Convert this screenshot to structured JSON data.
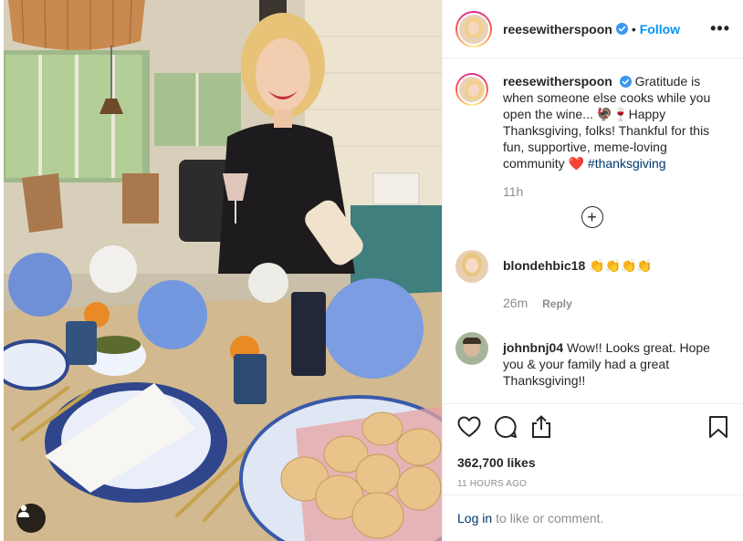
{
  "photo": {
    "alt": "photo",
    "tag_icon": "user-icon"
  },
  "header": {
    "username": "reesewitherspoon",
    "separator": "•",
    "follow_label": "Follow",
    "more_label": "•••"
  },
  "caption": {
    "username": "reesewitherspoon",
    "text": "Gratitude is when someone else cooks while you open the wine... 🦃🍷Happy Thanksgiving, folks! Thankful for this fun, supportive, meme-loving community ❤️",
    "hashtag": "#thanksgiving",
    "time": "11h"
  },
  "load_more": "+",
  "comments": [
    {
      "username": "blondehbic18",
      "text": "👏👏👏👏",
      "time": "26m",
      "reply_label": "Reply"
    },
    {
      "username": "johnbnj04",
      "text": "Wow!! Looks great. Hope you & your family had a great Thanksgiving!!"
    }
  ],
  "actions": {
    "like_icon": "heart-icon",
    "comment_icon": "comment-icon",
    "share_icon": "share-icon",
    "save_icon": "bookmark-icon",
    "likes": "362,700 likes",
    "ago": "11 HOURS AGO"
  },
  "login": {
    "link": "Log in",
    "rest": "to like or comment."
  },
  "colors": {
    "link_blue": "#0095f6",
    "verified_blue": "#3897f0",
    "hashtag": "#00376b",
    "muted": "#8e8e8e"
  }
}
